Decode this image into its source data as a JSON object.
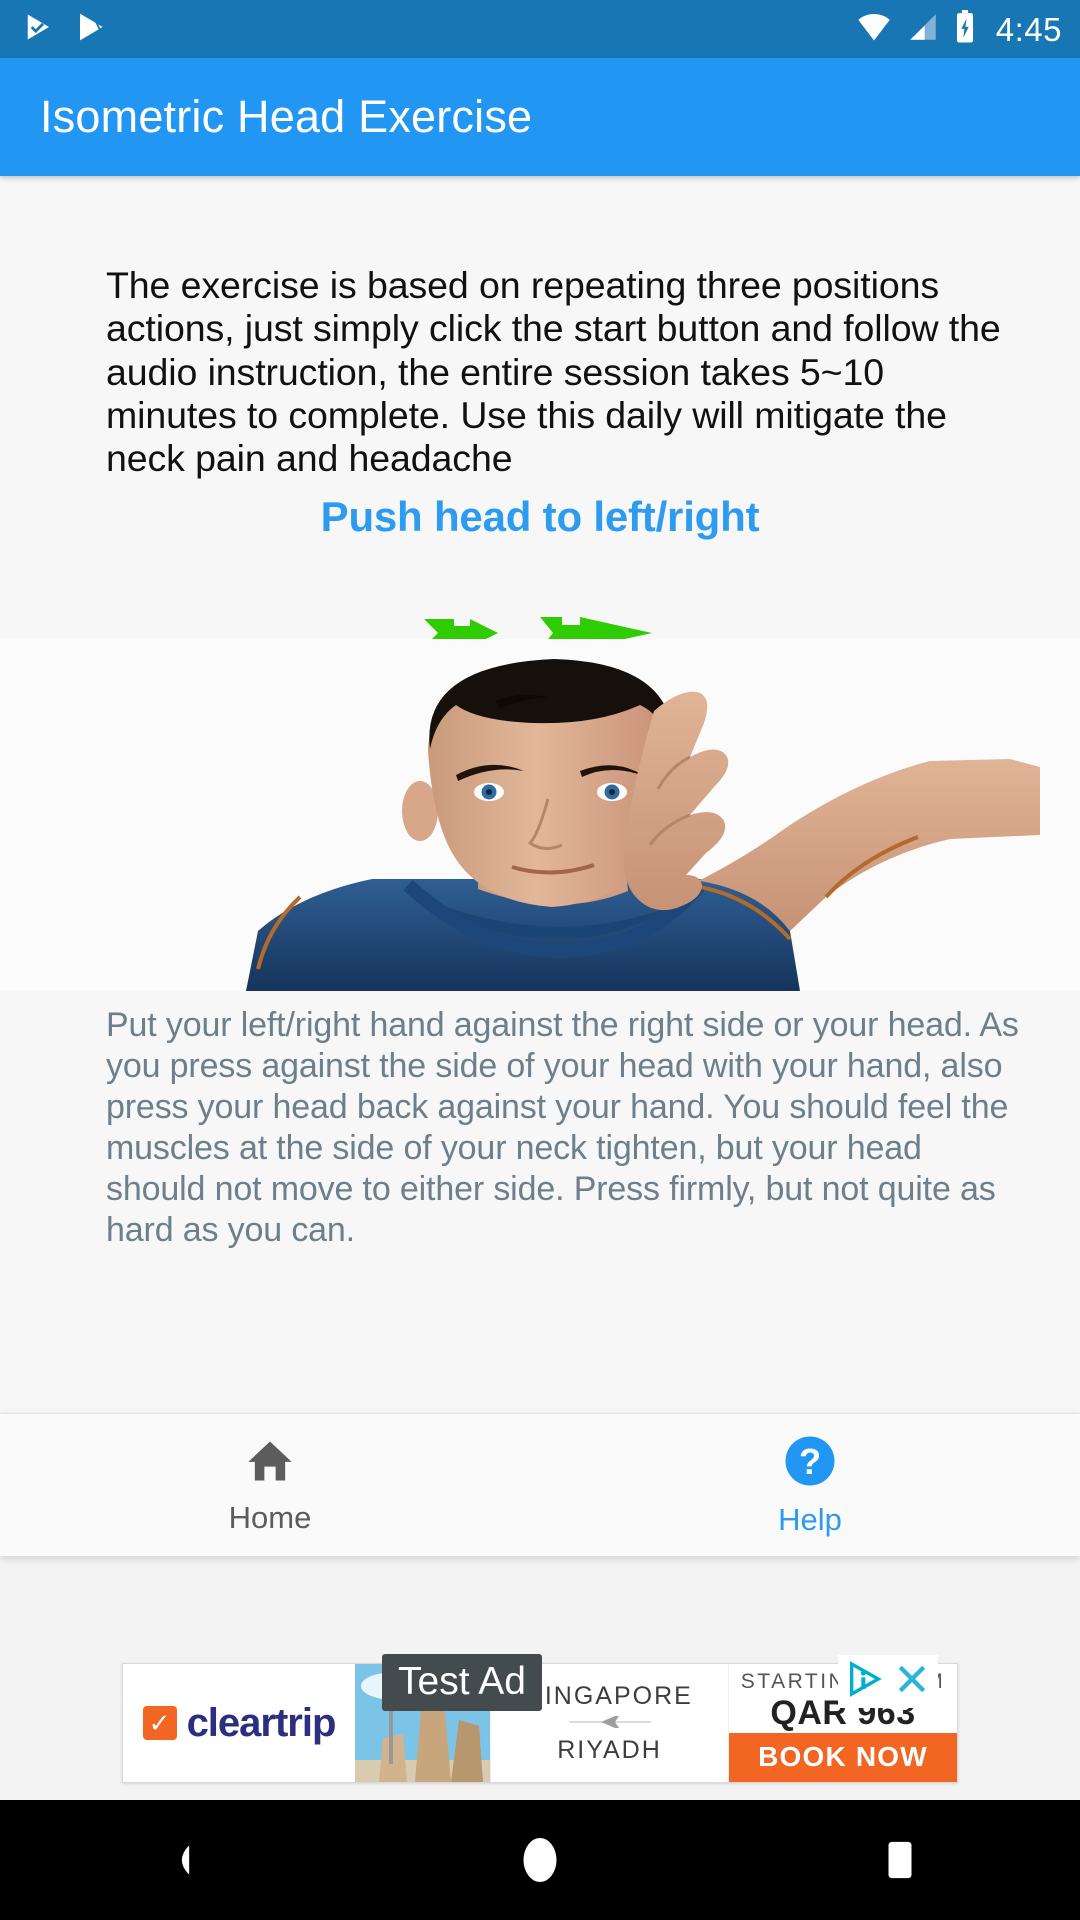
{
  "status_bar": {
    "time": "4:45",
    "icons": [
      "playstore-update-icon",
      "playstore-icon",
      "wifi-icon",
      "cellular-signal-icon",
      "battery-charging-icon"
    ],
    "background": "#1976b5"
  },
  "app_bar": {
    "title": "Isometric Head Exercise",
    "background": "#2196f3"
  },
  "main": {
    "intro": "The exercise is based on repeating three positions actions, just simply click the start button and follow the audio instruction, the entire session takes 5~10 minutes to complete. Use this daily will mitigate the neck pain and headache",
    "section_title": "Push head to left/right",
    "section_title_color": "#2d9cf0",
    "illustration": {
      "name": "head-side-press-illustration",
      "arrow_color": "#2ecc00",
      "left_arrow": "arrow-right-icon",
      "right_arrow": "arrow-left-icon",
      "alt": "Man pressing right hand against the side of his head"
    },
    "detail": "Put your left/right hand against the right side or your head. As you press against the side of your head with your hand, also press your head back against your hand. You should feel the muscles at the side of your neck tighten, but your head should not move to either side. Press firmly, but not quite as hard as you can.",
    "detail_color": "#6d7f8a"
  },
  "bottom_nav": {
    "items": [
      {
        "label": "Home",
        "icon": "home-icon",
        "active": false,
        "color": "#5d5d5d"
      },
      {
        "label": "Help",
        "icon": "help-circle-icon",
        "active": true,
        "color": "#2d9cf0"
      }
    ]
  },
  "ad": {
    "test_label": "Test Ad",
    "brand": "cleartrip",
    "brand_color": "#2b2f7f",
    "brand_mark_color": "#f26522",
    "origin_city": "SINGAPORE",
    "destination_city": "RIYADH",
    "starting_label": "STARTING FROM",
    "price": "QAR 963",
    "cta": "BOOK NOW",
    "cta_color": "#f26522",
    "adchoices_icon": "adchoices-icon",
    "close_icon": "close-icon"
  },
  "android_nav": {
    "back": "back-triangle-icon",
    "home": "home-circle-icon",
    "recents": "recents-square-icon"
  }
}
